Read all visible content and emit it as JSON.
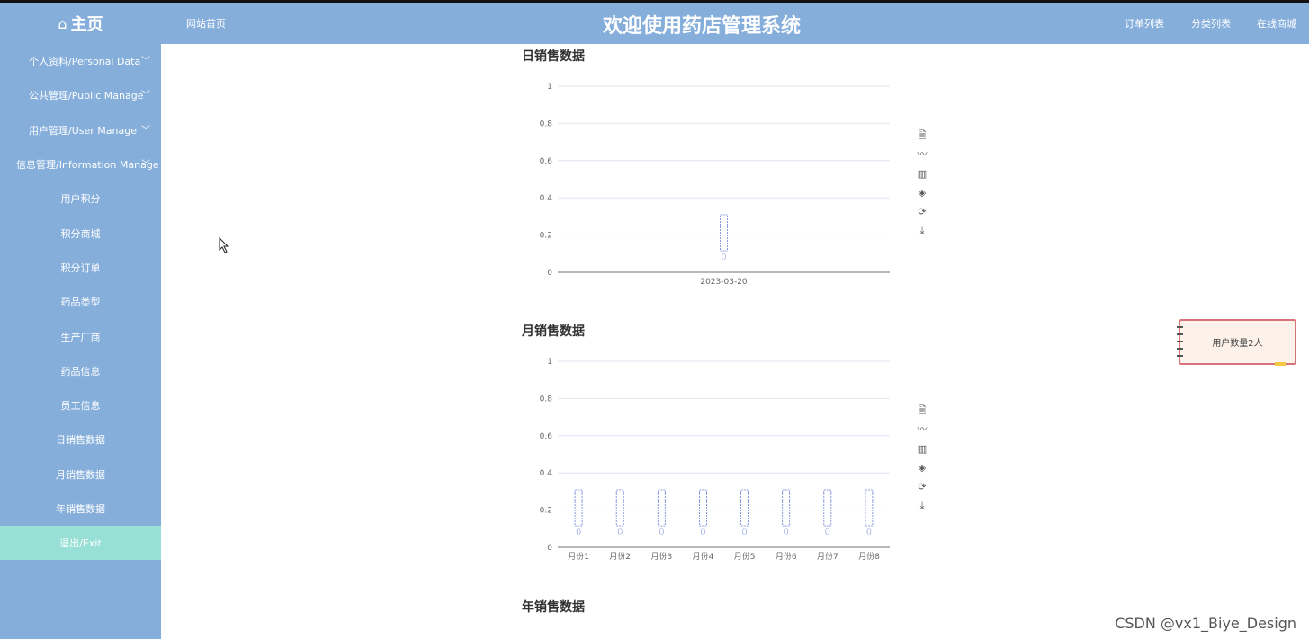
{
  "header": {
    "brand_icon": "home-icon",
    "brand": "主页",
    "nav_home": "网站首页",
    "title": "欢迎使用药店管理系统",
    "nav_right": [
      "订单列表",
      "分类列表",
      "在线商城"
    ]
  },
  "sidebar": {
    "groups": [
      {
        "label": "个人资料/Personal Data"
      },
      {
        "label": "公共管理/Public Manage"
      },
      {
        "label": "用户管理/User Manage"
      },
      {
        "label": "信息管理/Information Manage"
      }
    ],
    "items": [
      {
        "label": "用户积分"
      },
      {
        "label": "积分商城"
      },
      {
        "label": "积分订单"
      },
      {
        "label": "药品类型"
      },
      {
        "label": "生产厂商"
      },
      {
        "label": "药品信息"
      },
      {
        "label": "员工信息"
      },
      {
        "label": "日销售数据"
      },
      {
        "label": "月销售数据"
      },
      {
        "label": "年销售数据"
      }
    ],
    "exit": "退出/Exit"
  },
  "sections": {
    "daily": "日销售数据",
    "monthly": "月销售数据",
    "yearly": "年销售数据"
  },
  "toolbox_icons": [
    "data-view-icon",
    "line-chart-icon",
    "bar-chart-icon",
    "stack-icon",
    "restore-icon",
    "download-icon"
  ],
  "float_widget": {
    "text": "用户数量2人"
  },
  "watermark": "CSDN @vx1_Biye_Design",
  "colors": {
    "sidebar": "#85aedb",
    "exit": "#98e0d5",
    "label": "#6e7fd6"
  },
  "chart_data": [
    {
      "type": "bar",
      "title": "日销售数据",
      "categories": [
        "2023-03-20"
      ],
      "values": [
        0
      ],
      "yticks": [
        "0",
        "0.2",
        "0.4",
        "0.6",
        "0.8",
        "1"
      ],
      "ylim": [
        0,
        1
      ]
    },
    {
      "type": "bar",
      "title": "月销售数据",
      "categories": [
        "月份1",
        "月份2",
        "月份3",
        "月份4",
        "月份5",
        "月份6",
        "月份7",
        "月份8"
      ],
      "values": [
        0,
        0,
        0,
        0,
        0,
        0,
        0,
        0
      ],
      "yticks": [
        "0",
        "0.2",
        "0.4",
        "0.6",
        "0.8",
        "1"
      ],
      "ylim": [
        0,
        1
      ]
    }
  ]
}
